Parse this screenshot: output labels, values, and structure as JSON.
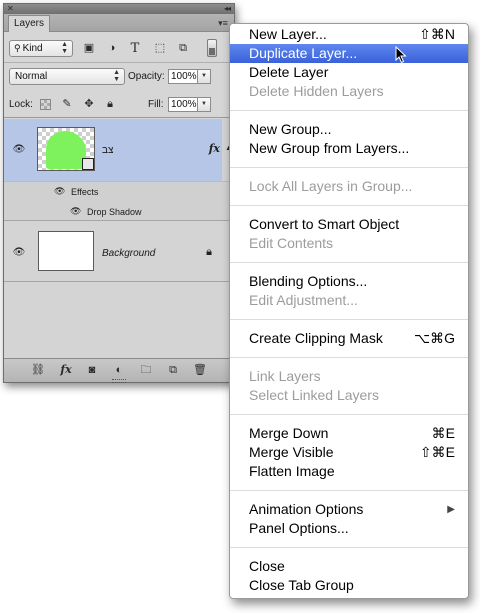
{
  "panel": {
    "tab_label": "Layers",
    "filter": {
      "kind_label": "Kind",
      "icons": [
        "pixel-filter-icon",
        "adjustment-filter-icon",
        "type-filter-icon",
        "shape-filter-icon",
        "smart-object-filter-icon"
      ]
    },
    "blend_mode": "Normal",
    "opacity_label": "Opacity:",
    "opacity_value": "100%",
    "lock_label": "Lock:",
    "fill_label": "Fill:",
    "fill_value": "100%",
    "layers": [
      {
        "name": "צב",
        "selected": true,
        "visible": true,
        "has_fx": true,
        "fx_label": "fx"
      },
      {
        "name": "Background",
        "selected": false,
        "visible": true,
        "locked": true
      }
    ],
    "effects_label": "Effects",
    "effect_items": [
      "Drop Shadow"
    ],
    "bottom_icons": [
      "link-layers-icon",
      "fx-icon",
      "mask-icon",
      "adjustment-icon",
      "group-folder-icon",
      "new-layer-icon",
      "trash-icon"
    ]
  },
  "menu": {
    "sections": [
      [
        {
          "label": "New Layer...",
          "shortcut": "⇧⌘N",
          "enabled": true
        },
        {
          "label": "Duplicate Layer...",
          "enabled": true,
          "highlighted": true
        },
        {
          "label": "Delete Layer",
          "enabled": true
        },
        {
          "label": "Delete Hidden Layers",
          "enabled": false
        }
      ],
      [
        {
          "label": "New Group...",
          "enabled": true
        },
        {
          "label": "New Group from Layers...",
          "enabled": true
        }
      ],
      [
        {
          "label": "Lock All Layers in Group...",
          "enabled": false
        }
      ],
      [
        {
          "label": "Convert to Smart Object",
          "enabled": true
        },
        {
          "label": "Edit Contents",
          "enabled": false
        }
      ],
      [
        {
          "label": "Blending Options...",
          "enabled": true
        },
        {
          "label": "Edit Adjustment...",
          "enabled": false
        }
      ],
      [
        {
          "label": "Create Clipping Mask",
          "shortcut": "⌥⌘G",
          "enabled": true
        }
      ],
      [
        {
          "label": "Link Layers",
          "enabled": false
        },
        {
          "label": "Select Linked Layers",
          "enabled": false
        }
      ],
      [
        {
          "label": "Merge Down",
          "shortcut": "⌘E",
          "enabled": true
        },
        {
          "label": "Merge Visible",
          "shortcut": "⇧⌘E",
          "enabled": true
        },
        {
          "label": "Flatten Image",
          "enabled": true
        }
      ],
      [
        {
          "label": "Animation Options",
          "enabled": true,
          "submenu": true
        },
        {
          "label": "Panel Options...",
          "enabled": true
        }
      ],
      [
        {
          "label": "Close",
          "enabled": true
        },
        {
          "label": "Close Tab Group",
          "enabled": true
        }
      ]
    ]
  },
  "colors": {
    "highlight": "#3f6be0",
    "selected_layer": "#b5c6e6",
    "disabled_text": "#9c9c9c",
    "layer_thumb_green": "#7ef25c"
  }
}
